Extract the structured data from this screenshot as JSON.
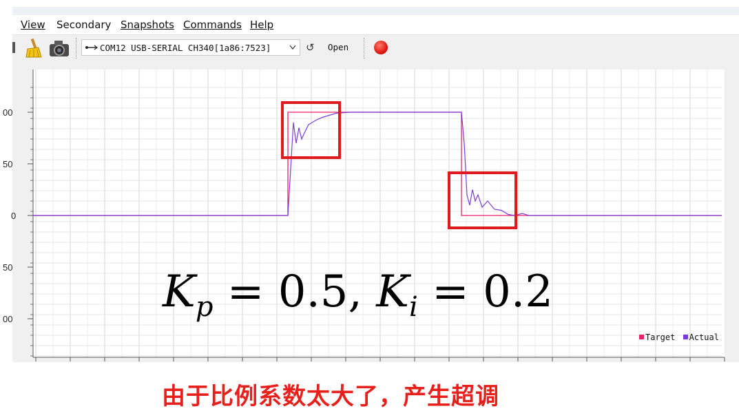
{
  "menu": {
    "items": [
      {
        "label": "View"
      },
      {
        "label": "Secondary"
      },
      {
        "label": "Snapshots"
      },
      {
        "label": "Commands"
      },
      {
        "label": "Help"
      }
    ]
  },
  "toolbar": {
    "port": "COM12 USB-SERIAL CH340[1a86:7523]",
    "open_label": "Open",
    "icons": [
      "broom-icon",
      "camera-icon",
      "usb-icon",
      "chevron-down-icon",
      "refresh-icon",
      "record-icon"
    ]
  },
  "chart_data": {
    "type": "line",
    "y_tick_labels": [
      "00",
      "50",
      "0",
      "50",
      "00"
    ],
    "legend_position": "bottom-right",
    "grid": true,
    "series": [
      {
        "name": "Target",
        "color": "#e8206e",
        "x": [
          0,
          370,
          370,
          622,
          622,
          1000
        ],
        "y": [
          0,
          0,
          100,
          100,
          0,
          0
        ]
      },
      {
        "name": "Actual",
        "color": "#7b3bd6",
        "x": [
          0,
          370,
          374,
          378,
          382,
          386,
          390,
          394,
          400,
          410,
          420,
          430,
          440,
          460,
          500,
          540,
          580,
          622,
          626,
          630,
          634,
          638,
          642,
          646,
          652,
          660,
          670,
          680,
          690,
          700,
          710,
          720,
          1000
        ],
        "y": [
          0,
          0,
          45,
          90,
          70,
          85,
          74,
          80,
          88,
          92,
          95,
          97,
          99,
          100,
          100,
          100,
          100,
          100,
          70,
          20,
          10,
          25,
          14,
          20,
          8,
          14,
          6,
          5,
          1,
          0,
          2,
          0,
          0
        ]
      }
    ]
  },
  "annotation": {
    "formula_kp": "K",
    "formula_p": "p",
    "formula_mid": " = 0.5, ",
    "formula_ki": "K",
    "formula_i": "i",
    "formula_end": " = 0.2",
    "caption": "由于比例系数太大了，产生超调"
  },
  "colors": {
    "highlight_box": "#e0191f",
    "caption": "#e8201c"
  }
}
